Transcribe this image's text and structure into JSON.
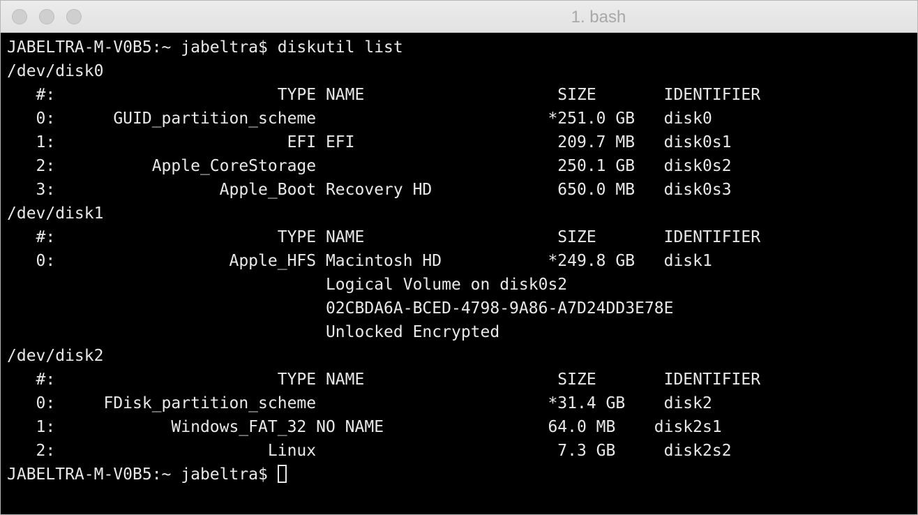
{
  "window": {
    "title": "1. bash"
  },
  "terminal": {
    "lines": [
      "JABELTRA-M-V0B5:~ jabeltra$ diskutil list",
      "/dev/disk0",
      "   #:                       TYPE NAME                    SIZE       IDENTIFIER",
      "   0:      GUID_partition_scheme                        *251.0 GB   disk0",
      "   1:                        EFI EFI                     209.7 MB   disk0s1",
      "   2:          Apple_CoreStorage                         250.1 GB   disk0s2",
      "   3:                 Apple_Boot Recovery HD             650.0 MB   disk0s3",
      "/dev/disk1",
      "   #:                       TYPE NAME                    SIZE       IDENTIFIER",
      "   0:                  Apple_HFS Macintosh HD           *249.8 GB   disk1",
      "                                 Logical Volume on disk0s2",
      "                                 02CBDA6A-BCED-4798-9A86-A7D24DD3E78E",
      "                                 Unlocked Encrypted",
      "/dev/disk2",
      "   #:                       TYPE NAME                    SIZE       IDENTIFIER",
      "   0:     FDisk_partition_scheme                        *31.4 GB    disk2",
      "   1:            Windows_FAT_32 NO NAME                 64.0 MB    disk2s1",
      "   2:                      Linux                         7.3 GB     disk2s2"
    ],
    "prompt": "JABELTRA-M-V0B5:~ jabeltra$ "
  },
  "colors": {
    "background": "#000000",
    "foreground": "#e8e8e8",
    "titlebar": "#e6e6e6",
    "title_text": "#a8a8a8"
  }
}
